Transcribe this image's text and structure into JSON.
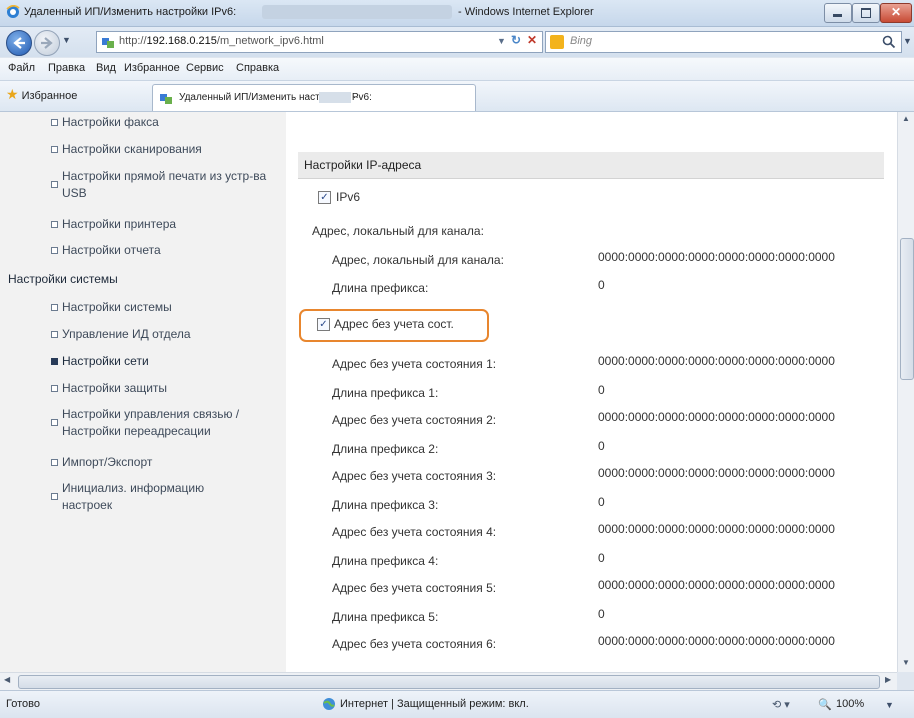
{
  "window": {
    "title": "Удаленный ИП/Изменить настройки IPv6:",
    "title_suffix": "- Windows Internet Explorer"
  },
  "address": {
    "url_prefix": "http://",
    "url_host": "192.168.0.215",
    "url_path": "/m_network_ipv6.html",
    "search_placeholder": "Bing"
  },
  "menu": [
    "Файл",
    "Правка",
    "Вид",
    "Избранное",
    "Сервис",
    "Справка"
  ],
  "favorites": {
    "label": "Избранное",
    "tab_title": "Удаленный ИП/Изменить настройки IPv6:"
  },
  "sidebar": {
    "items_top": [
      {
        "label": "Настройки факса"
      },
      {
        "label": "Настройки сканирования"
      },
      {
        "label": "Настройки прямой печати из устр-ва USB"
      },
      {
        "label": "Настройки принтера"
      },
      {
        "label": "Настройки отчета"
      }
    ],
    "section": "Настройки системы",
    "items_system": [
      {
        "label": "Настройки системы"
      },
      {
        "label": "Управление ИД отдела"
      },
      {
        "label": "Настройки сети",
        "active": true
      },
      {
        "label": "Настройки защиты"
      },
      {
        "label": "Настройки управления связью / Настройки переадресации"
      },
      {
        "label": "Импорт/Экспорт"
      },
      {
        "label": "Инициализ. информацию настроек"
      }
    ]
  },
  "main": {
    "section_title": "Настройки IP-адреса",
    "ipv6_checkbox": {
      "label": "IPv6",
      "checked": true
    },
    "link_local_heading": "Адрес, локальный для канала:",
    "link_local": [
      {
        "label": "Адрес, локальный для канала:",
        "value": "0000:0000:0000:0000:0000:0000:0000:0000"
      },
      {
        "label": "Длина префикса:",
        "value": "0"
      }
    ],
    "stateless_checkbox": {
      "label": "Адрес без учета сост.",
      "checked": true
    },
    "stateless": [
      {
        "label": "Адрес без учета состояния 1:",
        "value": "0000:0000:0000:0000:0000:0000:0000:0000"
      },
      {
        "label": "Длина префикса 1:",
        "value": "0"
      },
      {
        "label": "Адрес без учета состояния 2:",
        "value": "0000:0000:0000:0000:0000:0000:0000:0000"
      },
      {
        "label": "Длина префикса 2:",
        "value": "0"
      },
      {
        "label": "Адрес без учета состояния 3:",
        "value": "0000:0000:0000:0000:0000:0000:0000:0000"
      },
      {
        "label": "Длина префикса 3:",
        "value": "0"
      },
      {
        "label": "Адрес без учета состояния 4:",
        "value": "0000:0000:0000:0000:0000:0000:0000:0000"
      },
      {
        "label": "Длина префикса 4:",
        "value": "0"
      },
      {
        "label": "Адрес без учета состояния 5:",
        "value": "0000:0000:0000:0000:0000:0000:0000:0000"
      },
      {
        "label": "Длина префикса 5:",
        "value": "0"
      },
      {
        "label": "Адрес без учета состояния 6:",
        "value": "0000:0000:0000:0000:0000:0000:0000:0000"
      }
    ]
  },
  "status": {
    "ready": "Готово",
    "zone": "Интернет | Защищенный режим: вкл.",
    "zoom": "100%"
  },
  "colors": {
    "highlight": "#e8862e",
    "sidebar_bg": "#f2f2f2",
    "section_header_bg": "#ebebeb"
  }
}
